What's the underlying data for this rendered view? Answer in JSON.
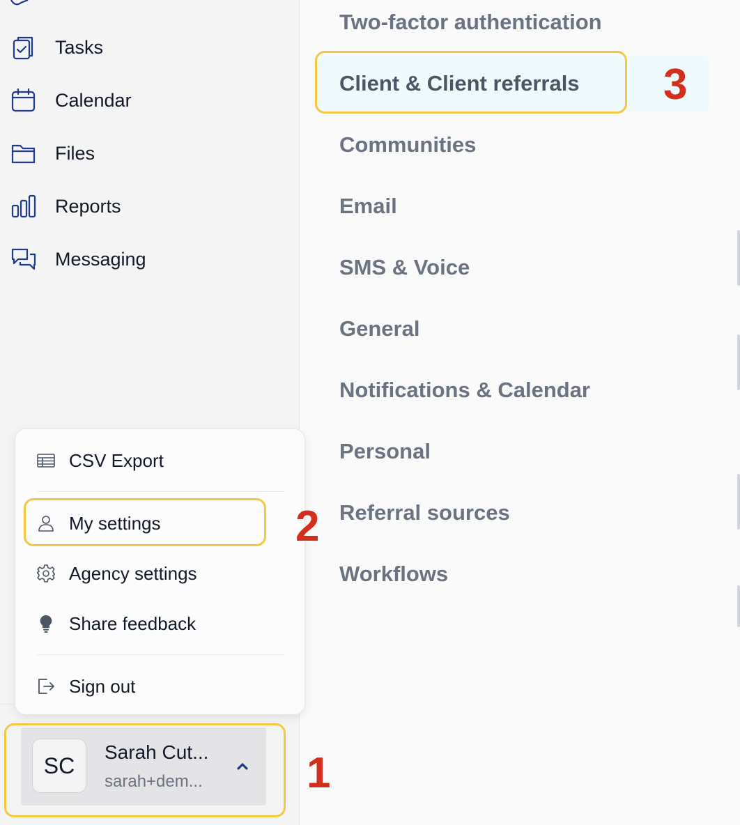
{
  "sidebar": {
    "items": [
      {
        "label": "Tasks",
        "icon": "clipboard-check-icon"
      },
      {
        "label": "Calendar",
        "icon": "calendar-icon"
      },
      {
        "label": "Files",
        "icon": "folder-icon"
      },
      {
        "label": "Reports",
        "icon": "bar-chart-icon"
      },
      {
        "label": "Messaging",
        "icon": "chat-bubbles-icon"
      }
    ]
  },
  "settings": {
    "items": [
      "Two-factor authentication",
      "Client & Client referrals",
      "Communities",
      "Email",
      "SMS & Voice",
      "General",
      "Notifications & Calendar",
      "Personal",
      "Referral sources",
      "Workflows"
    ],
    "active": "Client & Client referrals"
  },
  "menu": {
    "csv_export": "CSV Export",
    "my_settings": "My settings",
    "agency_settings": "Agency settings",
    "share_feedback": "Share feedback",
    "sign_out": "Sign out"
  },
  "user": {
    "initials": "SC",
    "name": "Sarah Cut...",
    "email": "sarah+dem..."
  },
  "steps": {
    "one": "1",
    "two": "2",
    "three": "3"
  },
  "colors": {
    "highlight": "#f5c842",
    "step_number": "#d32f1d",
    "icon_navy": "#1e3a8a",
    "active_row": "#eefafb"
  }
}
